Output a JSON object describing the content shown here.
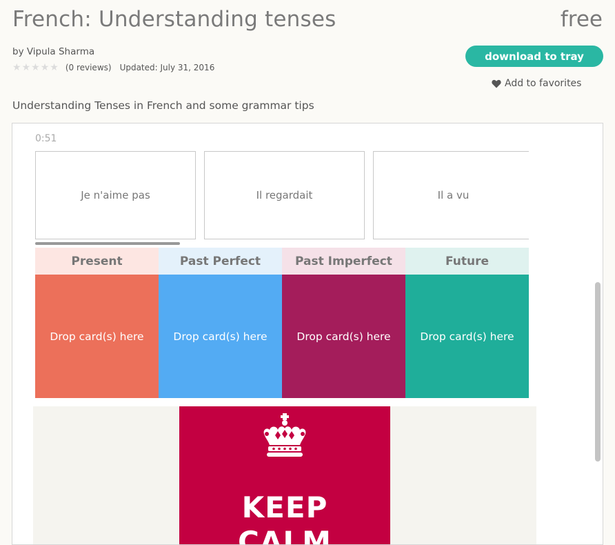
{
  "header": {
    "title": "French: Understanding tenses",
    "price": "free",
    "author": "by Vipula Sharma",
    "reviews": "(0 reviews)",
    "updated": "Updated: July 31, 2016",
    "rating": 0
  },
  "actions": {
    "download_label": "download to tray",
    "favorite_label": "Add to favorites"
  },
  "description": "Understanding Tenses in French and some grammar tips",
  "activity": {
    "timer": "0:51",
    "cards": [
      "Je n'aime pas",
      "Il regardait",
      "Il a vu"
    ],
    "categories": [
      {
        "label": "Present",
        "drop": "Drop card(s) here",
        "head_color": "#fde6e2",
        "body_color": "#ec705a"
      },
      {
        "label": "Past Perfect",
        "drop": "Drop card(s) here",
        "head_color": "#e4f1fb",
        "body_color": "#53abf3"
      },
      {
        "label": "Past Imperfect",
        "drop": "Drop card(s) here",
        "head_color": "#f5e1e8",
        "body_color": "#a41d5b"
      },
      {
        "label": "Future",
        "drop": "Drop card(s) here",
        "head_color": "#dff2ef",
        "body_color": "#1fae9a"
      }
    ]
  },
  "poster": {
    "line1": "KEEP",
    "line2": "CALM",
    "color": "#c30041"
  },
  "colors": {
    "accent": "#2ab7a3"
  }
}
